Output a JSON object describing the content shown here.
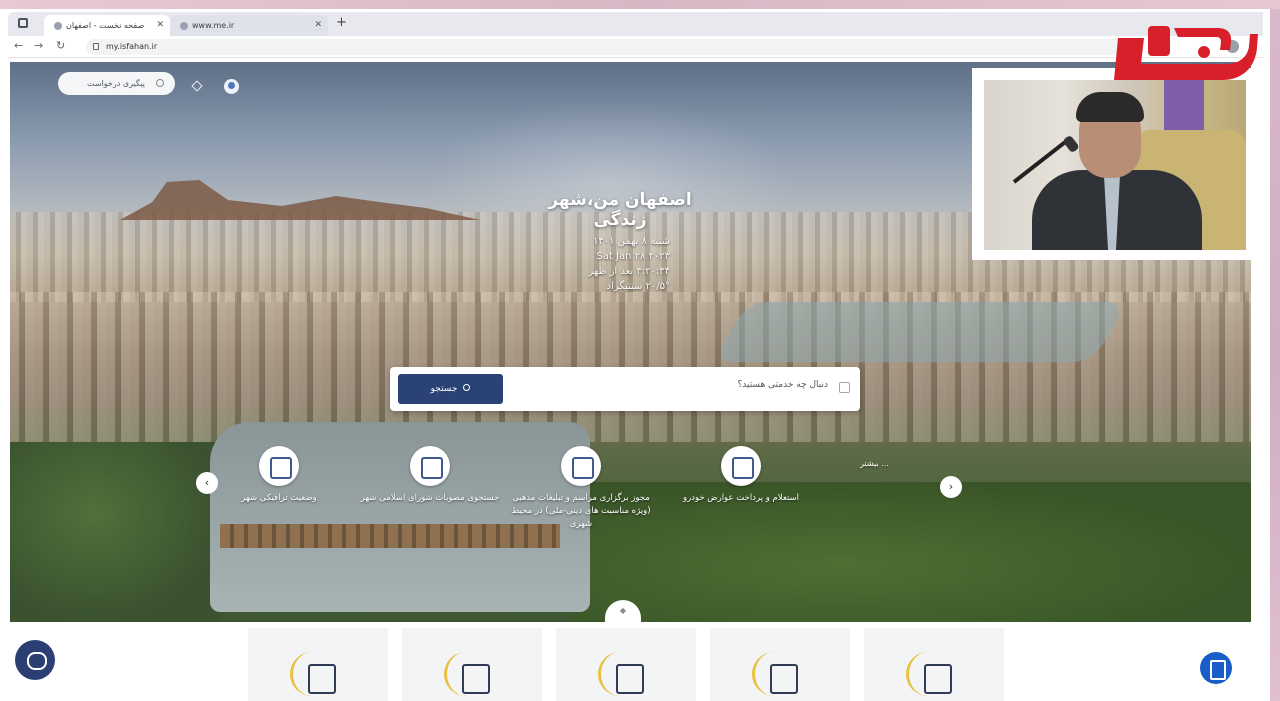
{
  "browser": {
    "tabs": [
      {
        "label": "صفحه نخست - اصفهان من"
      },
      {
        "label": "www.me.ir"
      }
    ],
    "new_tab_symbol": "+",
    "url": "my.isfahan.ir"
  },
  "header": {
    "search_placeholder": "پیگیری درخواست"
  },
  "hero": {
    "title": "اصفهان من،شهر زندگی",
    "info_lines": [
      "شنبه ۸ بهمن ۱۴۰۱",
      "Sat Jan ۲۸ ۲۰۲۳",
      "۳:۲۰:۳۴ بعد از ظهر",
      "۵°/۲۰ سنتيگراد"
    ],
    "search_placeholder": "دنبال چه خدمتی هستید؟",
    "search_button": "جستجو",
    "services": [
      {
        "label": "استعلام و پرداخت عوارض خودرو"
      },
      {
        "label": "مجوز برگزاری مراسم و تبلیغات مذهبی (ویژه مناسبت های دینی-ملی) در محیط شهری"
      },
      {
        "label": "جستجوی مصوبات شورای اسلامی شهر"
      },
      {
        "label": "وضعیت ترافیکی شهر"
      }
    ],
    "side_label": "بیشتر ...",
    "arrow_left": "‹",
    "arrow_right": "›",
    "handle_symbol": "◆"
  },
  "icons": {
    "search": "search-icon",
    "user": "user-icon",
    "chat": "chat-icon",
    "clipboard": "clipboard-icon"
  },
  "colors": {
    "primary": "#2b4277",
    "accent": "#e7c23f",
    "clip": "#1a5cc8",
    "logo_red": "#d9202a"
  }
}
